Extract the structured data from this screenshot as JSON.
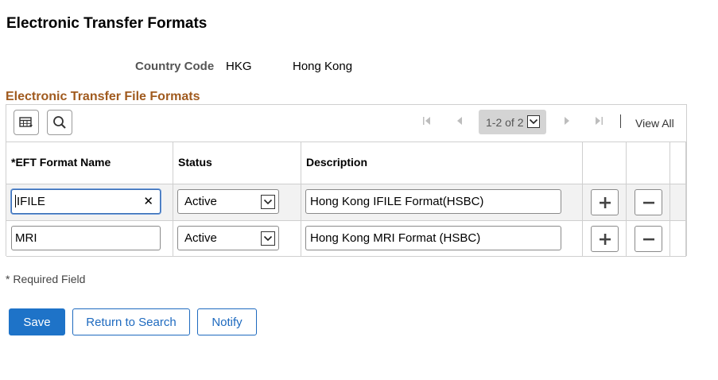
{
  "page": {
    "title": "Electronic Transfer Formats"
  },
  "country": {
    "label": "Country Code",
    "code": "HKG",
    "name": "Hong Kong"
  },
  "section": {
    "title": "Electronic Transfer File Formats"
  },
  "grid": {
    "pager": {
      "range": "1-2 of 2",
      "view_all": "View All"
    },
    "columns": {
      "format_name": "*EFT Format Name",
      "status": "Status",
      "description": "Description"
    },
    "rows": [
      {
        "format_name": "IFILE",
        "status": "Active",
        "description": "Hong Kong IFILE Format(HSBC)"
      },
      {
        "format_name": "MRI",
        "status": "Active",
        "description": "Hong Kong MRI Format (HSBC)"
      }
    ]
  },
  "footer": {
    "required_note": "* Required Field"
  },
  "buttons": {
    "save": "Save",
    "return": "Return to Search",
    "notify": "Notify"
  },
  "colors": {
    "accent": "#1e73c8",
    "section_title": "#a05a1e",
    "pager_bg": "#d4d4d4"
  },
  "icons": [
    "grid-settings-icon",
    "search-icon",
    "first-page-icon",
    "previous-page-icon",
    "next-page-icon",
    "last-page-icon",
    "clear-icon",
    "chevron-down-icon",
    "plus-icon",
    "minus-icon"
  ]
}
